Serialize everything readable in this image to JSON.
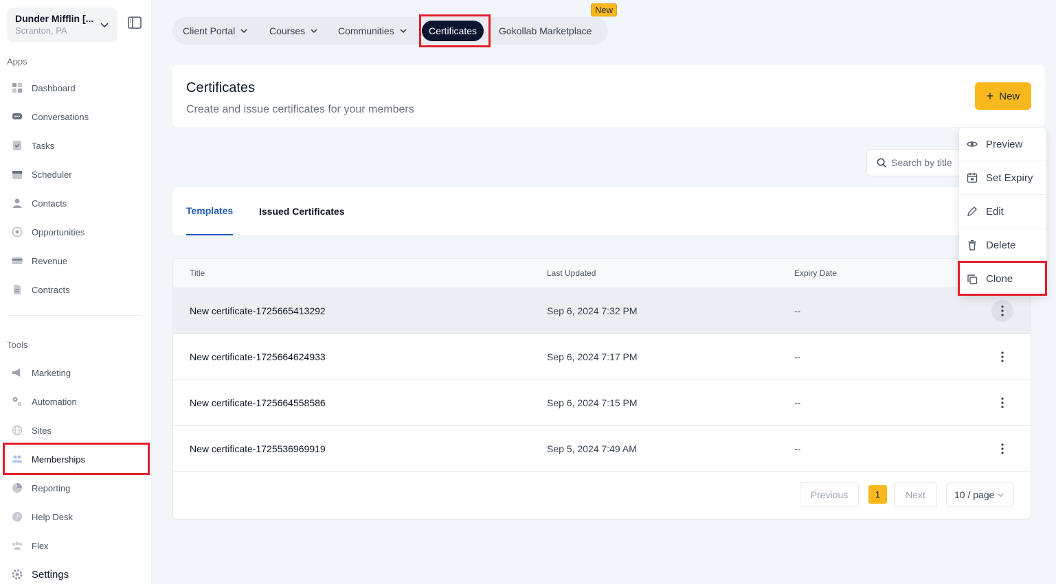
{
  "account": {
    "name": "Dunder Mifflin [...",
    "location": "Scranton, PA"
  },
  "sidebar": {
    "apps_label": "Apps",
    "tools_label": "Tools",
    "apps": [
      {
        "label": "Dashboard",
        "icon": "dashboard-icon"
      },
      {
        "label": "Conversations",
        "icon": "chat-icon"
      },
      {
        "label": "Tasks",
        "icon": "tasks-icon"
      },
      {
        "label": "Scheduler",
        "icon": "calendar-icon"
      },
      {
        "label": "Contacts",
        "icon": "person-icon"
      },
      {
        "label": "Opportunities",
        "icon": "target-icon"
      },
      {
        "label": "Revenue",
        "icon": "card-icon"
      },
      {
        "label": "Contracts",
        "icon": "document-icon"
      }
    ],
    "tools": [
      {
        "label": "Marketing",
        "icon": "megaphone-icon"
      },
      {
        "label": "Automation",
        "icon": "gears-icon"
      },
      {
        "label": "Sites",
        "icon": "globe-icon"
      },
      {
        "label": "Memberships",
        "icon": "members-icon"
      },
      {
        "label": "Reporting",
        "icon": "pie-icon"
      },
      {
        "label": "Help Desk",
        "icon": "help-icon"
      },
      {
        "label": "Flex",
        "icon": "team-icon"
      },
      {
        "label": "Settings",
        "icon": "gear-icon"
      }
    ]
  },
  "top_tabs": {
    "items": [
      "Client Portal",
      "Courses",
      "Communities",
      "Certificates",
      "Gokollab Marketplace"
    ],
    "new_badge": "New"
  },
  "header": {
    "title": "Certificates",
    "subtitle": "Create and issue certificates for your members",
    "new_label": "New"
  },
  "search": {
    "placeholder": "Search by title"
  },
  "sub_tabs": [
    "Templates",
    "Issued Certificates"
  ],
  "table": {
    "columns": [
      "Title",
      "Last Updated",
      "Expiry Date"
    ],
    "rows": [
      {
        "title": "New certificate-1725665413292",
        "updated": "Sep 6, 2024 7:32 PM",
        "expiry": "--"
      },
      {
        "title": "New certificate-1725664624933",
        "updated": "Sep 6, 2024 7:17 PM",
        "expiry": "--"
      },
      {
        "title": "New certificate-1725664558586",
        "updated": "Sep 6, 2024 7:15 PM",
        "expiry": "--"
      },
      {
        "title": "New certificate-1725536969919",
        "updated": "Sep 5, 2024 7:49 AM",
        "expiry": "--"
      }
    ]
  },
  "pagination": {
    "previous": "Previous",
    "current": "1",
    "next": "Next",
    "page_size": "10 / page"
  },
  "row_menu": [
    "Preview",
    "Set Expiry",
    "Edit",
    "Delete",
    "Clone"
  ],
  "colors": {
    "accent": "#f8b81c",
    "active_tab": "#0b1530",
    "link": "#1e5bb8",
    "highlight": "#e11d2a"
  }
}
